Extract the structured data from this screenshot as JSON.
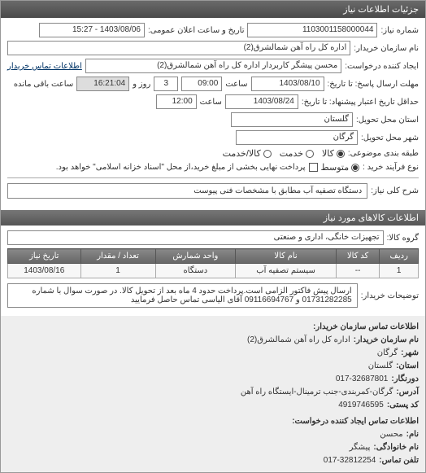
{
  "header": {
    "title": "جزئیات اطلاعات نیاز"
  },
  "form": {
    "request_no_label": "شماره نیاز:",
    "request_no": "1103001158000044",
    "public_date_label": "تاریخ و ساعت اعلان عمومی:",
    "public_date": "1403/08/06 - 15:27",
    "buyer_name_label": "نام سازمان خریدار:",
    "buyer_name": "اداره کل راه آهن شمالشرق(2)",
    "requester_label": "ایجاد کننده درخواست:",
    "requester": "محسن پیشگر کاربردار اداره کل راه آهن شمالشرق(2)",
    "buyer_contact_label": "اطلاعات تماس خریدار",
    "deadline_date_label": "مهلت ارسال پاسخ: تا تاریخ:",
    "deadline_date": "1403/08/10",
    "deadline_time_label": "ساعت",
    "deadline_time": "09:00",
    "remaining_label": "روز و",
    "remaining_days": "3",
    "remaining_time": "16:21:04",
    "remaining_suffix": "ساعت باقی مانده",
    "validity_label": "حداقل تاریخ اعتبار پیشنهاد: تا تاریخ:",
    "validity_date": "1403/08/24",
    "validity_time_label": "ساعت",
    "validity_time": "12:00",
    "province_label": "استان محل تحویل:",
    "province": "گلستان",
    "city_label": "شهر محل تحویل:",
    "city": "گرگان",
    "category_label": "طبقه بندی موضوعی:",
    "cat_options": {
      "goods": "کالا",
      "service": "خدمت",
      "both": "کالا/خدمت"
    },
    "purchase_type_label": "نوع فرآیند خرید :",
    "purchase_options": {
      "medium": "متوسط",
      "large": "پرداخت نهایی بخشی از مبلغ خرید،از محل \"اسناد خزانه اسلامی\" خواهد بود."
    },
    "need_title_label": "شرح کلی نیاز:",
    "need_title": "دستگاه تصفیه آب مطابق با مشخصات فنی پیوست"
  },
  "items_header": "اطلاعات کالاهای مورد نیاز",
  "group_label": "گروه کالا:",
  "group_value": "تجهیزات خانگی، اداری و صنعتی",
  "table": {
    "cols": {
      "row": "ردیف",
      "code": "کد کالا",
      "name": "نام کالا",
      "unit": "واحد شمارش",
      "qty": "تعداد / مقدار",
      "date": "تاریخ نیاز"
    },
    "rows": [
      {
        "row": "1",
        "code": "--",
        "name": "سیستم تصفیه آب",
        "unit": "دستگاه",
        "qty": "1",
        "date": "1403/08/16"
      }
    ]
  },
  "extra_label": "توضیحات خریدار:",
  "extra_text": "ارسال پیش فاکتور الزامی است.پرداخت حدود 4 ماه بعد از تحویل کالا. در صورت سوال با شماره 01731282285 و 09116694767 آقای الیاسی تماس حاصل فرمایید",
  "contact": {
    "title": "اطلاعات تماس سازمان خریدار:",
    "org_label": "نام سازمان خریدار:",
    "org": "اداره کل راه آهن شمالشرق(2)",
    "city_label": "شهر:",
    "city": "گرگان",
    "province_label": "استان:",
    "province": "گلستان",
    "fax_label": "دورنگار:",
    "fax": "017-32687801",
    "address_label": "آدرس:",
    "address": "گرگان-کمربندی-جنب ترمینال-ایستگاه راه آهن",
    "postal_label": "کد پستی:",
    "postal": "4919746595",
    "req_contact_title": "اطلاعات تماس ایجاد کننده درخواست:",
    "name_label": "نام:",
    "name": "محسن",
    "family_label": "نام خانوادگی:",
    "family": "پیشگر",
    "phone_label": "تلفن تماس:",
    "phone": "017-32812254"
  }
}
